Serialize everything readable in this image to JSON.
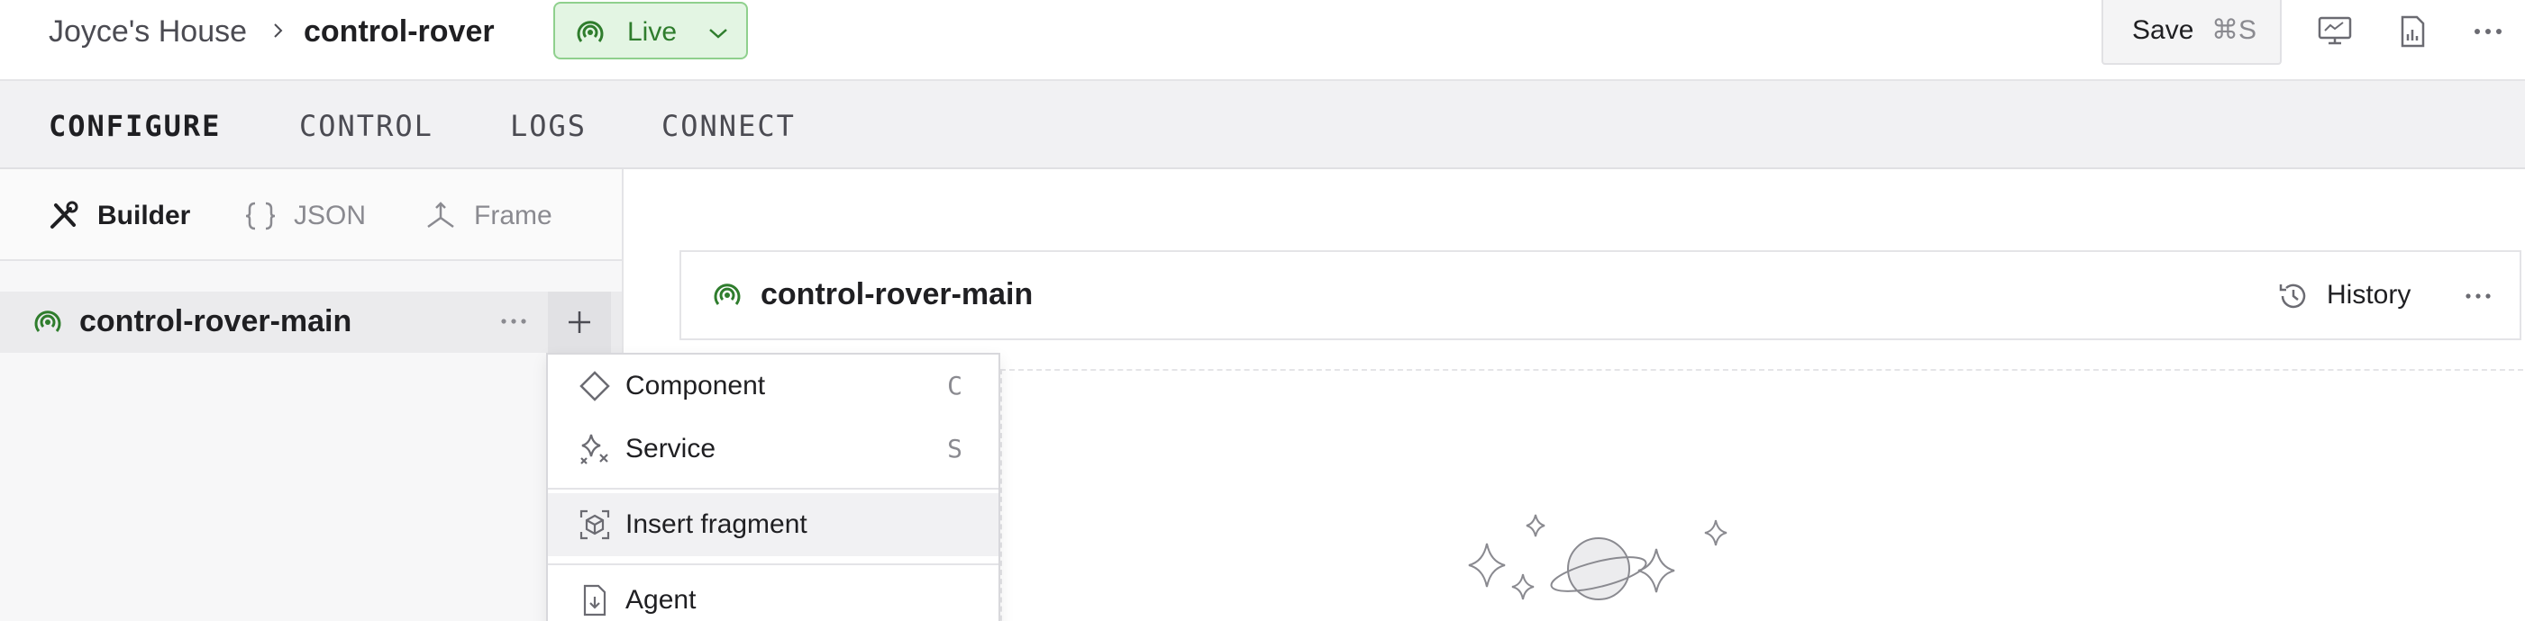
{
  "breadcrumb": {
    "root": "Joyce's House",
    "current": "control-rover"
  },
  "status": {
    "label": "Live",
    "color": "#2f7d2d"
  },
  "toolbar": {
    "save_label": "Save",
    "save_shortcut": "⌘S"
  },
  "header_icons": [
    "monitor-icon",
    "report-icon",
    "more-icon"
  ],
  "nav": {
    "tabs": [
      {
        "label": "CONFIGURE",
        "active": true
      },
      {
        "label": "CONTROL",
        "active": false
      },
      {
        "label": "LOGS",
        "active": false
      },
      {
        "label": "CONNECT",
        "active": false
      }
    ]
  },
  "modes": [
    {
      "label": "Builder",
      "icon": "tools-icon",
      "active": true
    },
    {
      "label": "JSON",
      "icon": "braces-icon",
      "active": false
    },
    {
      "label": "Frame",
      "icon": "axes-icon",
      "active": false
    }
  ],
  "tree": {
    "root_label": "control-rover-main"
  },
  "add_menu": {
    "items": [
      {
        "label": "Component",
        "shortcut": "C",
        "icon": "diamond-icon"
      },
      {
        "label": "Service",
        "shortcut": "S",
        "icon": "sparkles-icon"
      },
      {
        "label": "Insert fragment",
        "shortcut": "",
        "icon": "fragment-icon"
      },
      {
        "label": "Agent",
        "shortcut": "",
        "icon": "file-download-icon"
      }
    ]
  },
  "main": {
    "title": "control-rover-main",
    "history_label": "History"
  },
  "colors": {
    "accent_green": "#2f7d2d",
    "live_bg": "#e3f5e3",
    "nav_bg": "#f1f1f3"
  }
}
